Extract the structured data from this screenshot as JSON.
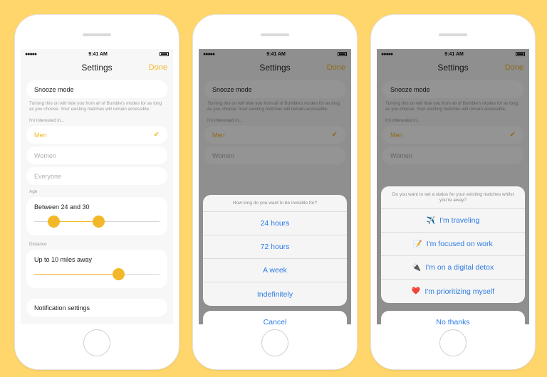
{
  "status_bar": {
    "signal": "●●●●●",
    "time": "9:41 AM"
  },
  "nav": {
    "title": "Settings",
    "done": "Done"
  },
  "settings": {
    "snooze_label": "Snooze mode",
    "snooze_help": "Turning this on will hide you from all of Bumble's modes for as long as you choose. Your existing matches will remain accessible.",
    "interested_label": "I'm interested in...",
    "interested_options": [
      {
        "label": "Men",
        "selected": true
      },
      {
        "label": "Women",
        "selected": false
      },
      {
        "label": "Everyone",
        "selected": false
      }
    ],
    "age_label": "Age",
    "age_value": "Between 24 and 30",
    "age_range": {
      "min": 24,
      "max": 30
    },
    "distance_label": "Distance",
    "distance_value": "Up to 10 miles away",
    "distance_miles": 10,
    "notification_label": "Notification settings"
  },
  "duration_sheet": {
    "title": "How long do you want to be invisible for?",
    "options": [
      "24 hours",
      "72 hours",
      "A week",
      "Indefinitely"
    ],
    "cancel": "Cancel"
  },
  "status_sheet": {
    "title": "Do you want to set a status for your existing matches whilst you're away?",
    "options": [
      {
        "icon": "airplane-icon",
        "emoji": "✈️",
        "label": "I'm traveling"
      },
      {
        "icon": "memo-icon",
        "emoji": "📝",
        "label": "I'm focused on work"
      },
      {
        "icon": "plug-icon",
        "emoji": "🔌",
        "label": "I'm on a digital detox"
      },
      {
        "icon": "heart-icon",
        "emoji": "❤️",
        "label": "I'm prioritizing myself"
      }
    ],
    "dismiss": "No thanks"
  },
  "colors": {
    "background": "#FFD66B",
    "accent": "#F3B829",
    "action_blue": "#2C7BE5"
  }
}
